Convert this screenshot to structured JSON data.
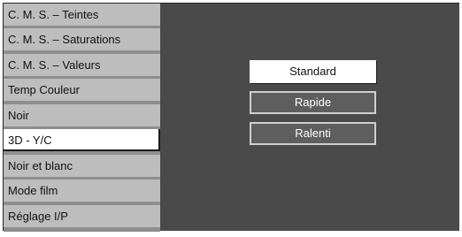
{
  "menu": {
    "items": [
      {
        "label": "C. M. S. – Teintes"
      },
      {
        "label": "C. M. S. – Saturations"
      },
      {
        "label": "C. M. S. – Valeurs"
      },
      {
        "label": "Temp Couleur"
      },
      {
        "label": "Noir"
      },
      {
        "label": "3D - Y/C",
        "selected": true
      },
      {
        "label": "Noir et blanc"
      },
      {
        "label": "Mode film"
      },
      {
        "label": "Réglage I/P"
      }
    ]
  },
  "options": {
    "items": [
      {
        "label": "Standard",
        "selected": true
      },
      {
        "label": "Rapide",
        "selected": false
      },
      {
        "label": "Ralenti",
        "selected": false
      }
    ]
  },
  "colors": {
    "menu_bg": "#bdbdbd",
    "selected_bg": "#ffffff",
    "panel_bg": "#4a4a4a",
    "option_off_bg": "#5e5e5e"
  }
}
